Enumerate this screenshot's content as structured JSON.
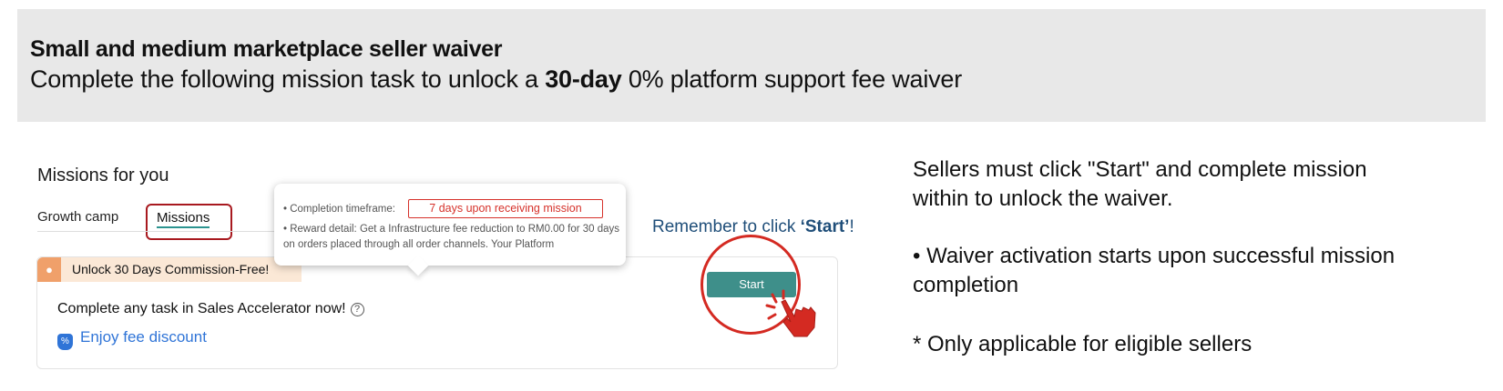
{
  "banner": {
    "title": "Small and medium marketplace seller waiver",
    "subtitle_prefix": "Complete the following mission task to unlock a ",
    "subtitle_bold": "30-day",
    "subtitle_suffix": " 0% platform support fee waiver"
  },
  "panel": {
    "title": "Missions for you",
    "tabs": [
      {
        "label": "Growth camp"
      },
      {
        "label": "Missions"
      }
    ],
    "card": {
      "tag": "Unlock 30 Days Commission-Free!",
      "main": "Complete any task in Sales Accelerator now!",
      "link": "Enjoy fee discount"
    },
    "tooltip": {
      "timeframe_label": "Completion timeframe:",
      "timeframe_value": "7 days upon receiving mission",
      "reward_label": "Reward detail:",
      "reward_text": "Get a Infrastructure fee reduction to RM0.00 for 30 days on orders placed through all order channels. Your Platform"
    },
    "remember_prefix": "Remember to click ",
    "remember_bold": "‘Start’",
    "remember_suffix": "!",
    "start_label": "Start"
  },
  "notes": {
    "line1": "Sellers must click \"Start\" and complete mission within to unlock the waiver.",
    "line2": "• Waiver activation starts upon successful mission completion",
    "line3": "* Only applicable for eligible sellers"
  },
  "colors": {
    "accent_teal": "#3e8f8a",
    "highlight_red": "#d42a22",
    "link_blue": "#2f74d7",
    "banner_grey": "#e8e8e8"
  }
}
